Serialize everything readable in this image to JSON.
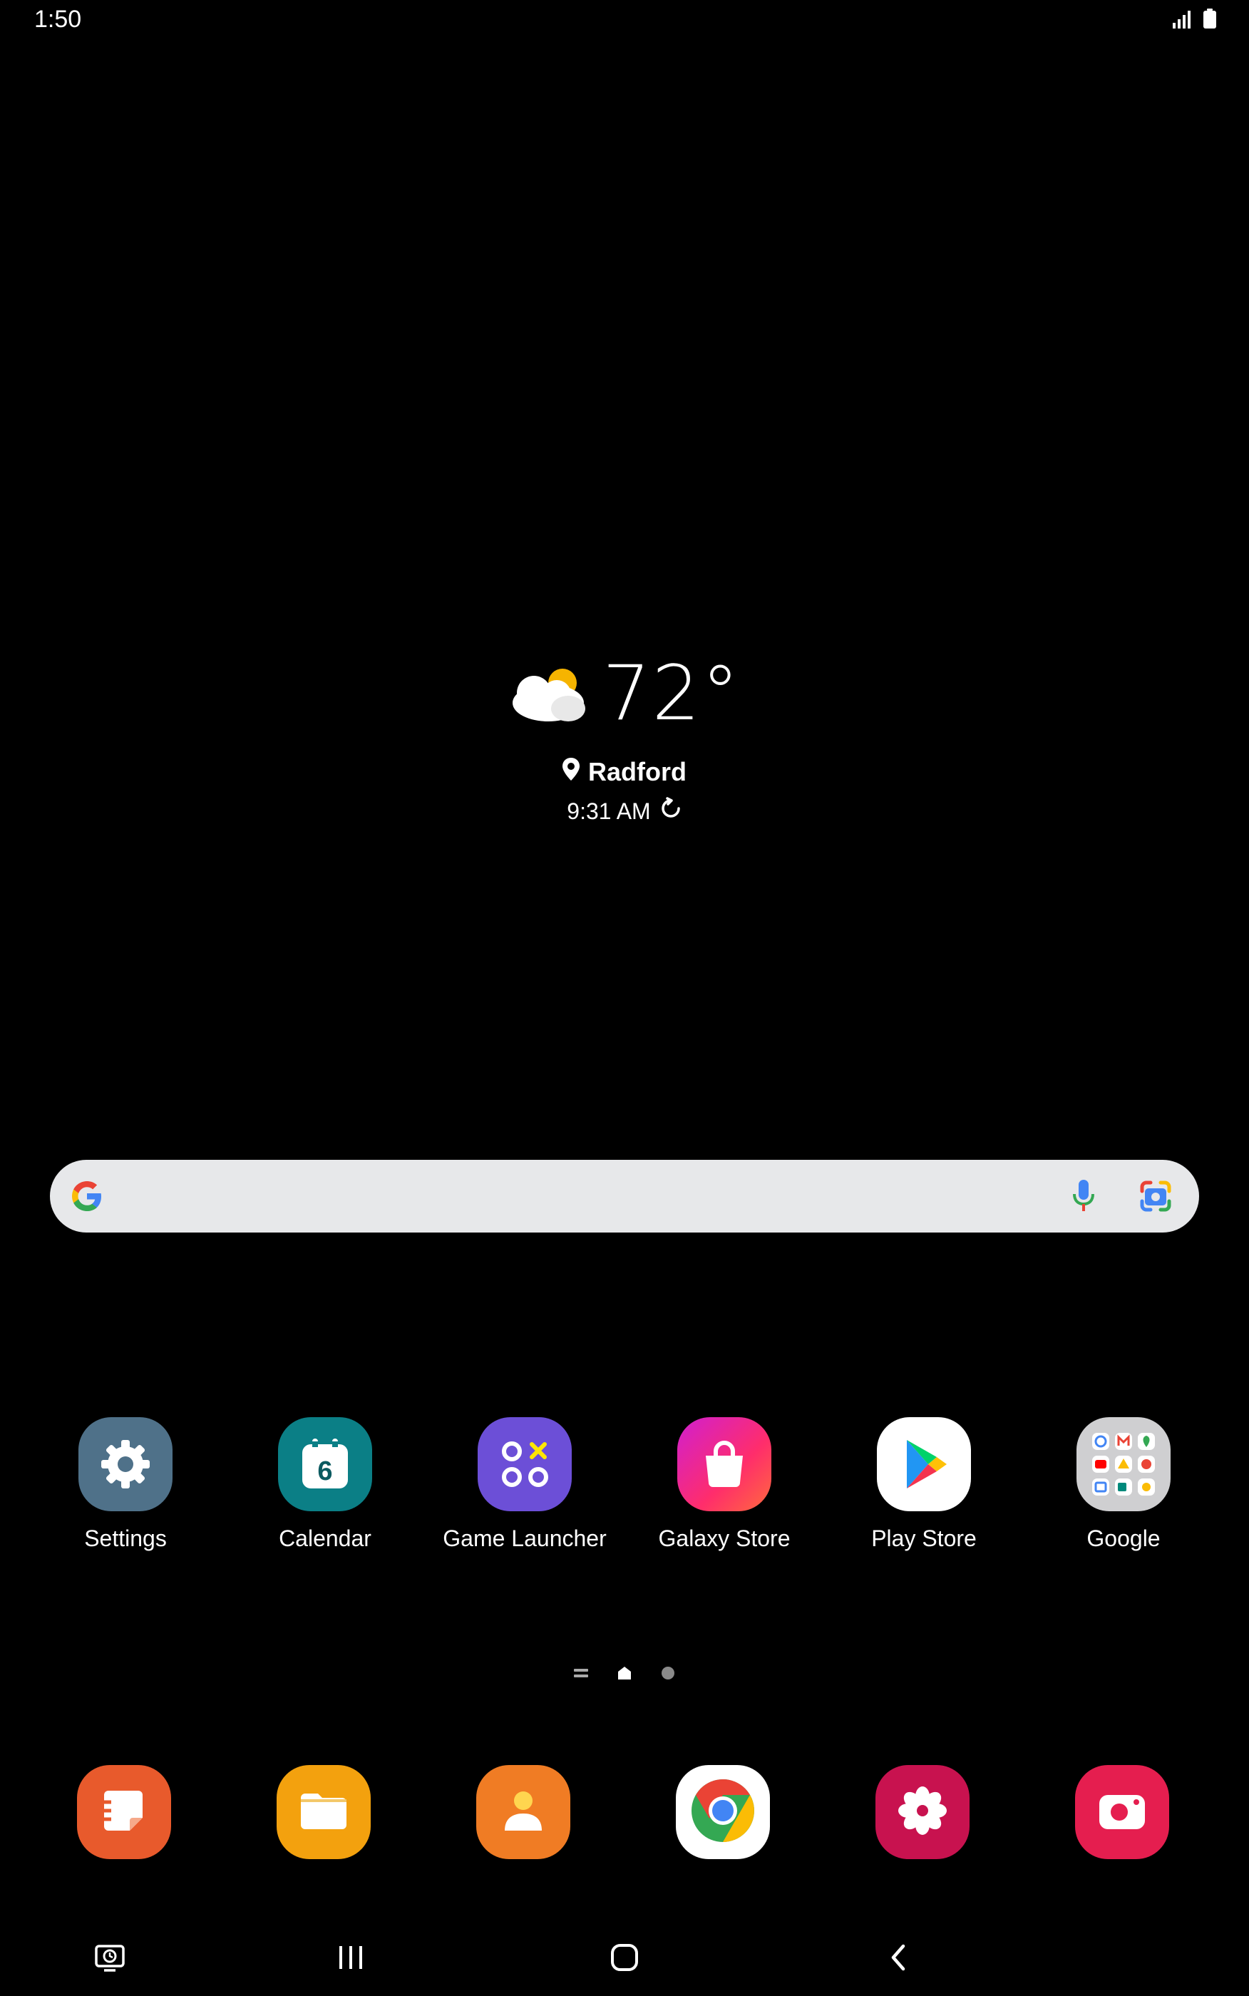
{
  "status_bar": {
    "time": "1:50",
    "icons": [
      "signal-icon",
      "battery-icon"
    ]
  },
  "weather": {
    "temperature": "72°",
    "location": "Radford",
    "updated_time": "9:31 AM",
    "condition_icon": "partly-cloudy-icon"
  },
  "search_bar": {
    "icons": [
      "google-g-icon",
      "microphone-icon",
      "google-lens-icon"
    ]
  },
  "apps": [
    {
      "label": "Settings",
      "icon": "gear-icon",
      "color": "#4f7189"
    },
    {
      "label": "Calendar",
      "icon": "calendar-icon",
      "color": "#0b7f86",
      "day": "6"
    },
    {
      "label": "Game Launcher",
      "icon": "game-launcher-icon",
      "color": "#6c4fd7"
    },
    {
      "label": "Galaxy Store",
      "icon": "shopping-bag-icon",
      "color": "#e8217a"
    },
    {
      "label": "Play Store",
      "icon": "play-store-icon",
      "color": "#ffffff"
    },
    {
      "label": "Google",
      "icon": "google-folder-icon",
      "color": "#cfcfd1"
    }
  ],
  "pager": {
    "indicators": [
      "list-page-icon",
      "home-page-icon",
      "page-dot-icon"
    ]
  },
  "dock": [
    {
      "name": "notes-app",
      "icon": "notes-icon",
      "color": "#e85a2c"
    },
    {
      "name": "my-files-app",
      "icon": "folder-icon",
      "color": "#f3a10e"
    },
    {
      "name": "contacts-app",
      "icon": "contacts-icon",
      "color": "#f07c24"
    },
    {
      "name": "chrome-app",
      "icon": "chrome-icon",
      "color": "#ffffff"
    },
    {
      "name": "gallery-app",
      "icon": "flower-icon",
      "color": "#c8124f"
    },
    {
      "name": "camera-app",
      "icon": "camera-icon",
      "color": "#e51e4f"
    }
  ],
  "nav_bar": {
    "buttons": [
      "screen-recorder-icon",
      "recent-apps-icon",
      "home-icon",
      "back-icon"
    ]
  }
}
